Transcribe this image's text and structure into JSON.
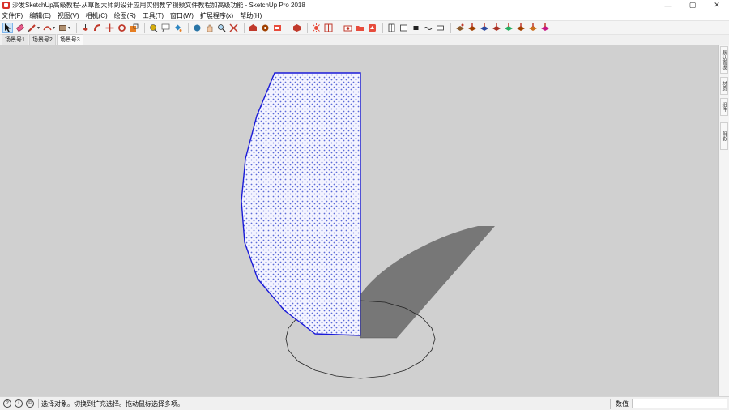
{
  "window": {
    "title": "沙发SketchUp高级教程-从草图大师到设计应用实例教学视频文件教程加高级功能 - SketchUp Pro 2018",
    "minimize": "—",
    "maximize": "▢",
    "close": "✕"
  },
  "menu": [
    "文件(F)",
    "编辑(E)",
    "视图(V)",
    "相机(C)",
    "绘图(R)",
    "工具(T)",
    "窗口(W)",
    "扩展程序(x)",
    "帮助(H)"
  ],
  "toolbar": {
    "icons": [
      "select-icon",
      "eraser-icon",
      "pencil-icon",
      "arc-icon",
      "rectangle-icon",
      "pushpull-icon",
      "follow-me-icon",
      "move-icon",
      "rotate-icon",
      "scale-icon",
      "tape-measure-icon",
      "text-icon",
      "paint-bucket-icon",
      "orbit-icon",
      "pan-icon",
      "zoom-icon",
      "zoom-extents-icon",
      "3d-warehouse-icon",
      "extension-warehouse-icon",
      "layout-icon",
      "component-icon",
      "group-icon",
      "shadow-icon",
      "section-icon",
      "camera-icon",
      "folder-icon",
      "ruby-icon",
      "iso-view-icon",
      "top-view-icon",
      "front-view-icon",
      "right-view-icon",
      "back-view-icon",
      "sandbox-1-icon",
      "sandbox-2-icon",
      "sandbox-3-icon",
      "sandbox-4-icon",
      "sandbox-5-icon",
      "sandbox-6-icon",
      "sandbox-7-icon",
      "sandbox-8-icon"
    ]
  },
  "scenes": [
    "场景号1",
    "场景号2",
    "场景号3"
  ],
  "tray": [
    "默认面板",
    "材质",
    "组件",
    "阴影"
  ],
  "status": {
    "hint": "选择对象。切换到扩充选择。拖动鼠标选择多项。",
    "measure_label": "数值",
    "measure_value": ""
  },
  "colors": {
    "viewport_bg": "#d0d0d0",
    "face_edge": "#1a1ad8",
    "shadow": "#777777",
    "selection_pattern": "#5a6ad8"
  }
}
